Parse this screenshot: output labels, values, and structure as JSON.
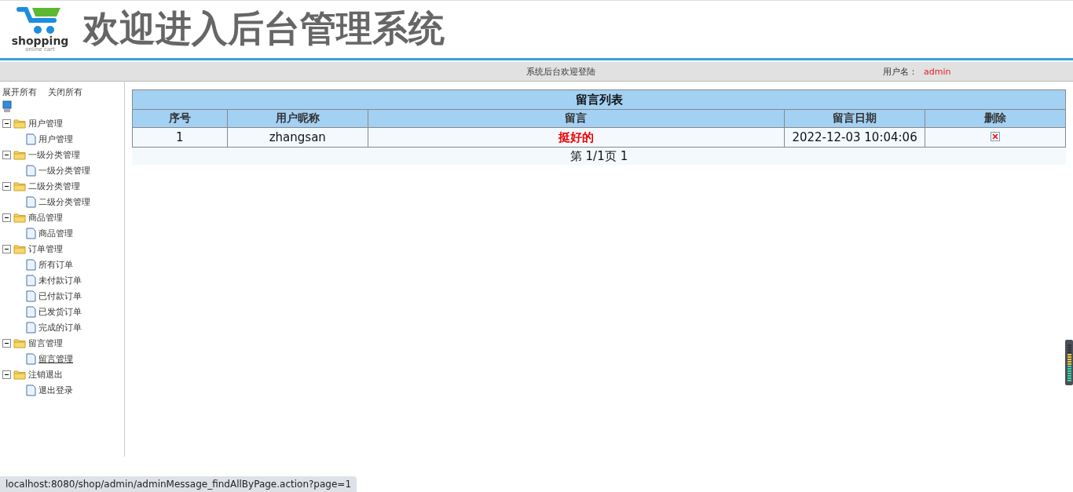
{
  "header": {
    "logo_text": "shopping",
    "logo_subtext": "online cart",
    "title": "欢迎进入后台管理系统"
  },
  "topbar": {
    "welcome": "系统后台欢迎登陆",
    "user_label": "用户名：",
    "user_name": "admin"
  },
  "sidebar": {
    "expand_all": "展开所有",
    "collapse_all": "关闭所有",
    "tree": [
      {
        "label": "用户管理",
        "expanded": true,
        "children": [
          {
            "label": "用户管理",
            "selected": false
          }
        ]
      },
      {
        "label": "一级分类管理",
        "expanded": true,
        "children": [
          {
            "label": "一级分类管理",
            "selected": false
          }
        ]
      },
      {
        "label": "二级分类管理",
        "expanded": true,
        "children": [
          {
            "label": "二级分类管理",
            "selected": false
          }
        ]
      },
      {
        "label": "商品管理",
        "expanded": true,
        "children": [
          {
            "label": "商品管理",
            "selected": false
          }
        ]
      },
      {
        "label": "订单管理",
        "expanded": true,
        "children": [
          {
            "label": "所有订单",
            "selected": false
          },
          {
            "label": "未付款订单",
            "selected": false
          },
          {
            "label": "已付款订单",
            "selected": false
          },
          {
            "label": "已发货订单",
            "selected": false
          },
          {
            "label": "完成的订单",
            "selected": false
          }
        ]
      },
      {
        "label": "留言管理",
        "expanded": true,
        "children": [
          {
            "label": "留言管理",
            "selected": true
          }
        ]
      },
      {
        "label": "注销退出",
        "expanded": true,
        "children": [
          {
            "label": "退出登录",
            "selected": false
          }
        ]
      }
    ]
  },
  "table": {
    "title": "留言列表",
    "columns": [
      "序号",
      "用户昵称",
      "留言",
      "留言日期",
      "删除"
    ],
    "rows": [
      {
        "index": "1",
        "nickname": "zhangsan",
        "message": "挺好的",
        "date": "2022-12-03 10:04:06"
      }
    ]
  },
  "pager": {
    "text": "第 1/1页",
    "page_link": "1"
  },
  "status_bar": {
    "url": "localhost:8080/shop/admin/adminMessage_findAllByPage.action?page=1"
  }
}
